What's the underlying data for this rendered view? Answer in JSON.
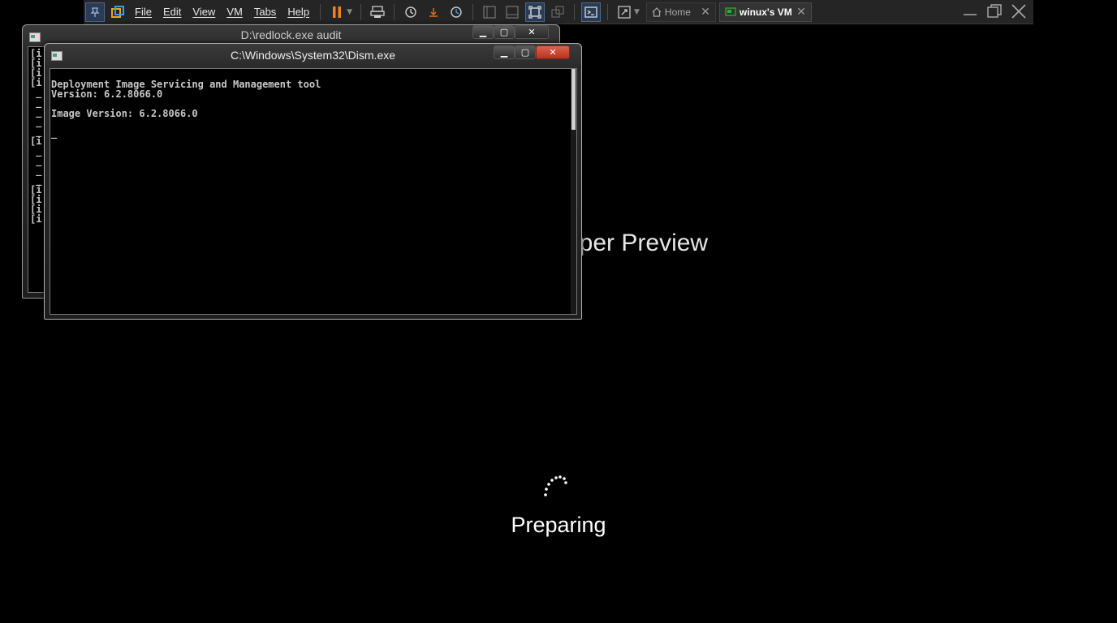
{
  "toolbar": {
    "menu": [
      "File",
      "Edit",
      "View",
      "VM",
      "Tabs",
      "Help"
    ],
    "tabs": [
      {
        "label": "Home",
        "icon": "home-icon"
      },
      {
        "label": "winux's VM",
        "icon": "vm-icon"
      }
    ]
  },
  "back_window": {
    "title": "D:\\redlock.exe audit",
    "lines": [
      "[i",
      "[i",
      "[i",
      "[i",
      " _",
      " _",
      " _",
      " _",
      " _",
      "[i",
      " _",
      " _",
      " _",
      " _",
      "[i",
      "[i",
      "[i",
      "[i"
    ]
  },
  "front_window": {
    "title": "C:\\Windows\\System32\\Dism.exe",
    "lines": [
      "Deployment Image Servicing and Management tool",
      "Version: 6.2.8066.0",
      "",
      "Image Version: 6.2.8066.0",
      "",
      "_"
    ]
  },
  "setup": {
    "title_fragment": "oper Preview",
    "status": "Preparing"
  }
}
